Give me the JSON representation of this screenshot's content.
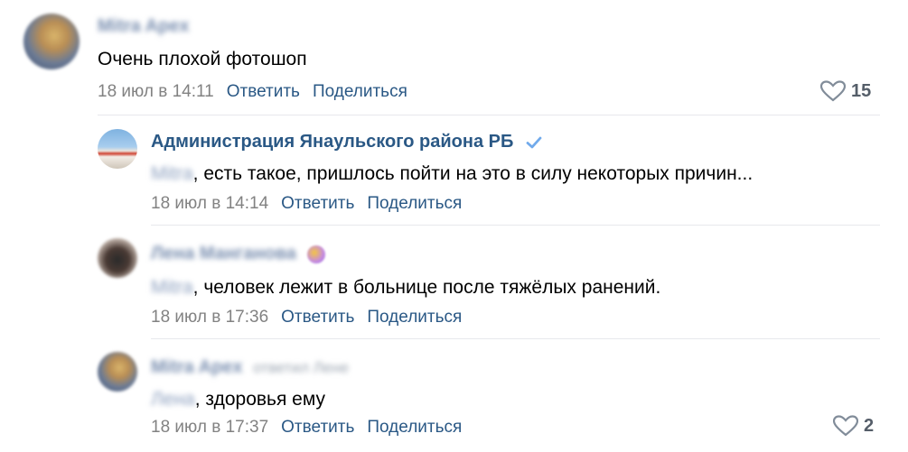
{
  "comments": [
    {
      "author": "Mitra Apex",
      "text": "Очень плохой фотошоп",
      "date": "18 июл в 14:11",
      "reply_label": "Ответить",
      "share_label": "Поделиться",
      "likes": "15"
    },
    {
      "author": "Администрация Янаульского района РБ",
      "mention": "Mitra",
      "text": ", есть такое, пришлось пойти на это в силу некоторых причин...",
      "date": "18 июл в 14:14",
      "reply_label": "Ответить",
      "share_label": "Поделиться"
    },
    {
      "author": "Лена Манганова",
      "mention": "Mitra",
      "text": ", человек лежит в больнице после тяжёлых ранений.",
      "date": "18 июл в 17:36",
      "reply_label": "Ответить",
      "share_label": "Поделиться"
    },
    {
      "author": "Mitra Apex",
      "reply_to": "ответил Лене",
      "mention": "Лена",
      "text": ", здоровья ему",
      "date": "18 июл в 17:37",
      "reply_label": "Ответить",
      "share_label": "Поделиться",
      "likes": "2"
    }
  ],
  "colors": {
    "link": "#2a5885",
    "date": "#828282",
    "divider": "#e7e8ec"
  }
}
